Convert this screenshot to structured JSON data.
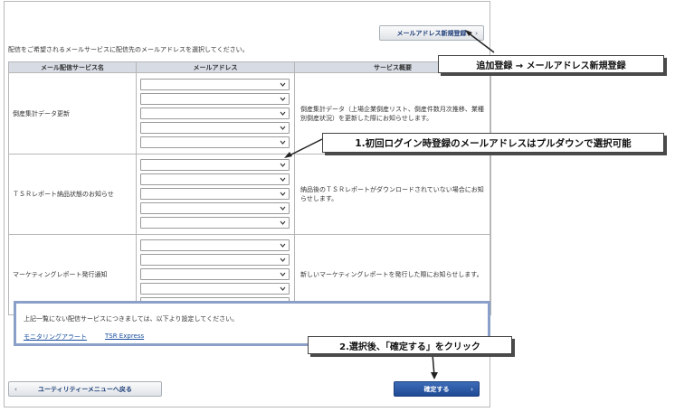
{
  "top_button": {
    "label": "メールアドレス新規登録"
  },
  "instruction": "配信をご希望されるメールサービスに配信先のメールアドレスを選択してください。",
  "table": {
    "headers": [
      "メール配信サービス名",
      "メールアドレス",
      "サービス概要"
    ],
    "rows": [
      {
        "name": "倒産集計データ更新",
        "desc": "倒産集計データ（上場企業倒産リスト、倒産件数月次推移、業種別倒産状況）を更新した際にお知らせします。"
      },
      {
        "name": "ＴＳＲレポート納品状態のお知らせ",
        "desc": "納品後のＴＳＲレポートがダウンロードされていない場合にお知らせします。"
      },
      {
        "name": "マーケティングレポート発行通知",
        "desc": "新しいマーケティングレポートを発行した際にお知らせします。"
      }
    ]
  },
  "notice": {
    "message": "上記一覧にない配信サービスにつきましては、以下より設定してください。",
    "links": [
      "モニタリングアラート",
      "TSR Express"
    ]
  },
  "back_button": {
    "label": "ユーティリティーメニューへ戻る"
  },
  "confirm_button": {
    "label": "確定する"
  },
  "callouts": {
    "add": "追加登録 → メールアドレス新規登録",
    "dropdown": "1.初回ログイン時登録のメールアドレスはプルダウンで選択可能",
    "confirm": "2.選択後、「確定する」をクリック"
  },
  "colors": {
    "header_bg": "#d6dbe4",
    "confirm_bg": "#2a5aa6",
    "link": "#1a4fa0",
    "notice_border": "#8aa0c8"
  }
}
